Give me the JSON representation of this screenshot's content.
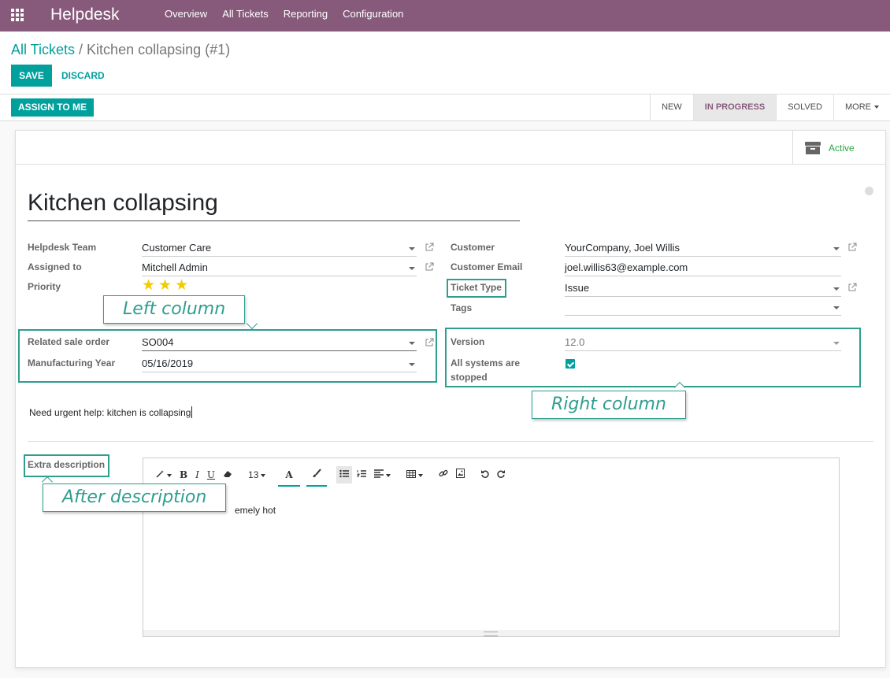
{
  "navbar": {
    "app_name": "Helpdesk",
    "menu": [
      "Overview",
      "All Tickets",
      "Reporting",
      "Configuration"
    ]
  },
  "breadcrumb": {
    "parent": "All Tickets",
    "separator": "/",
    "current": "Kitchen collapsing (#1)"
  },
  "actions": {
    "save": "SAVE",
    "discard": "DISCARD"
  },
  "statusbar": {
    "assign": "ASSIGN TO ME",
    "stages": [
      "NEW",
      "IN PROGRESS",
      "SOLVED",
      "MORE"
    ],
    "active_stage": "IN PROGRESS"
  },
  "buttonbox": {
    "active_label": "Active"
  },
  "ticket": {
    "title": "Kitchen collapsing",
    "left": {
      "helpdesk_team_label": "Helpdesk Team",
      "helpdesk_team": "Customer Care",
      "assigned_to_label": "Assigned to",
      "assigned_to": "Mitchell Admin",
      "priority_label": "Priority",
      "priority_stars": 3,
      "related_sale_order_label": "Related sale order",
      "related_sale_order": "SO004",
      "manufacturing_year_label": "Manufacturing Year",
      "manufacturing_year": "05/16/2019"
    },
    "right": {
      "customer_label": "Customer",
      "customer": "YourCompany, Joel Willis",
      "customer_email_label": "Customer Email",
      "customer_email": "joel.willis63@example.com",
      "ticket_type_label": "Ticket Type",
      "ticket_type": "Issue",
      "tags_label": "Tags",
      "tags": "",
      "version_label": "Version",
      "version": "12.0",
      "all_systems_stopped_label_1": "All systems are",
      "all_systems_stopped_label_2": "stopped",
      "all_systems_stopped": true
    },
    "description": "Need urgent help: kitchen is collapsing",
    "extra_description_label": "Extra description",
    "extra_description": "emely hot"
  },
  "editor_toolbar": {
    "bold": "B",
    "italic": "I",
    "underline": "U",
    "font_size": "13",
    "font_color": "A"
  },
  "annotations": {
    "left_column": "Left column",
    "right_column": "Right column",
    "after_description": "After description"
  },
  "colors": {
    "navbar": "#875a7b",
    "primary": "#00a09d",
    "annotation": "#2e9e8f",
    "star": "#f3cc00",
    "active_status": "#28a745"
  }
}
